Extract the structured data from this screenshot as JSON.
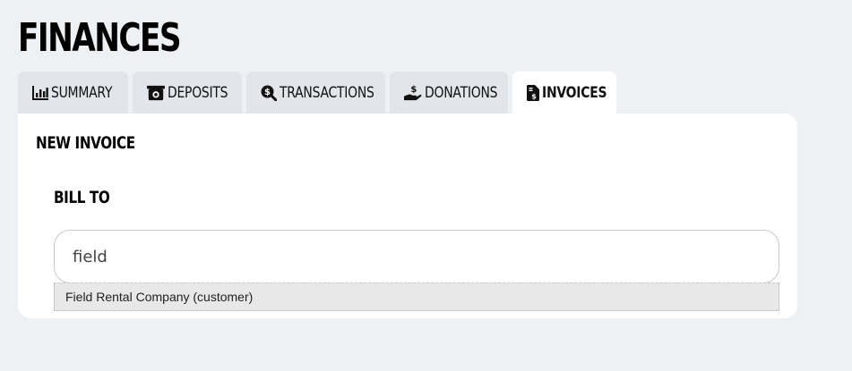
{
  "page": {
    "title": "FINANCES"
  },
  "tabs": [
    {
      "label": "SUMMARY",
      "icon": "bar-chart-icon",
      "active": false
    },
    {
      "label": "DEPOSITS",
      "icon": "cash-register-icon",
      "active": false
    },
    {
      "label": "TRANSACTIONS",
      "icon": "search-dollar-icon",
      "active": false
    },
    {
      "label": "DONATIONS",
      "icon": "hand-holding-dollar-icon",
      "active": false
    },
    {
      "label": "INVOICES",
      "icon": "file-invoice-dollar-icon",
      "active": true
    }
  ],
  "invoice_form": {
    "heading": "NEW INVOICE",
    "bill_to_label": "BILL TO",
    "bill_to_value": "field",
    "suggestions": [
      "Field Rental Company (customer)"
    ]
  },
  "colors": {
    "background": "#eef1f4",
    "tab_inactive": "#e2e5e9",
    "tab_active": "#ffffff",
    "panel": "#ffffff",
    "suggestion_bg": "#e8e8e8"
  }
}
